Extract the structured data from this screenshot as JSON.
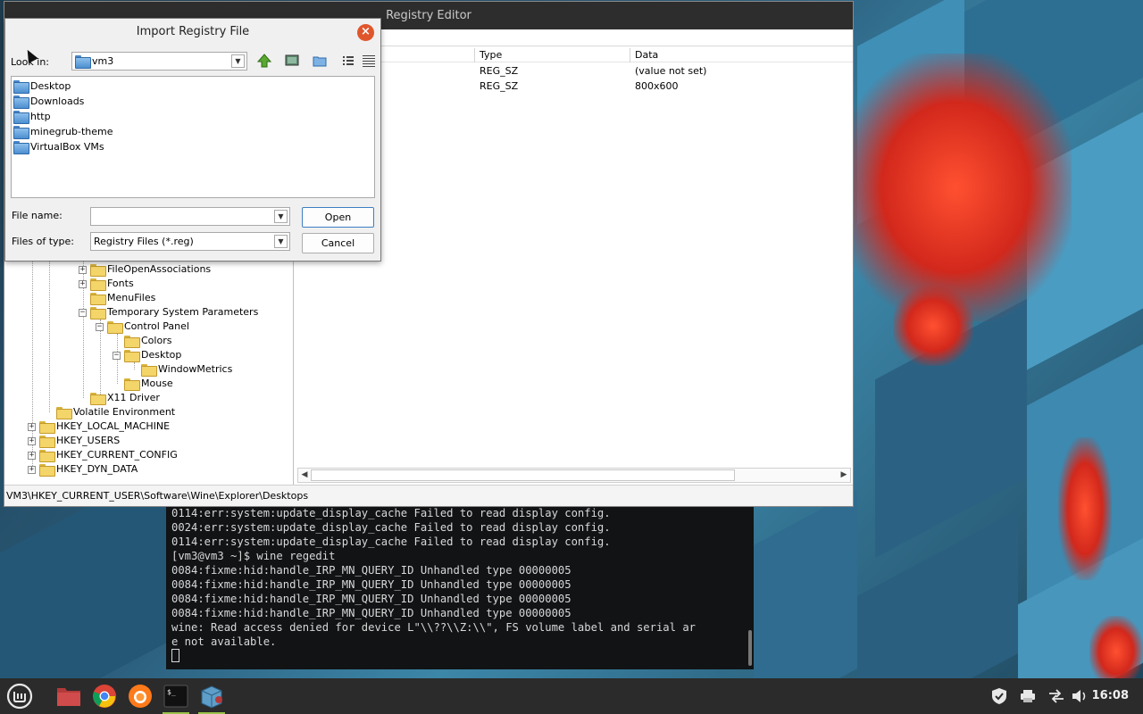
{
  "regedit": {
    "title": "Registry Editor",
    "tree": [
      {
        "label": "FileOpenAssociations",
        "toggle": "+"
      },
      {
        "label": "Fonts",
        "toggle": "+"
      },
      {
        "label": "MenuFiles",
        "toggle": ""
      },
      {
        "label": "Temporary System Parameters",
        "toggle": "−"
      },
      {
        "label": "Control Panel",
        "toggle": "−"
      },
      {
        "label": "Colors",
        "toggle": ""
      },
      {
        "label": "Desktop",
        "toggle": "−"
      },
      {
        "label": "WindowMetrics",
        "toggle": ""
      },
      {
        "label": "Mouse",
        "toggle": ""
      },
      {
        "label": "X11 Driver",
        "toggle": ""
      },
      {
        "label": "Volatile Environment",
        "toggle": ""
      },
      {
        "label": "HKEY_LOCAL_MACHINE",
        "toggle": "+"
      },
      {
        "label": "HKEY_USERS",
        "toggle": "+"
      },
      {
        "label": "HKEY_CURRENT_CONFIG",
        "toggle": "+"
      },
      {
        "label": "HKEY_DYN_DATA",
        "toggle": "+"
      }
    ],
    "columns": {
      "type": "Type",
      "data": "Data"
    },
    "rows": [
      {
        "type": "REG_SZ",
        "data": "(value not set)"
      },
      {
        "type": "REG_SZ",
        "data": "800x600"
      }
    ],
    "status_path": "VM3\\HKEY_CURRENT_USER\\Software\\Wine\\Explorer\\Desktops"
  },
  "dialog": {
    "title": "Import Registry File",
    "look_in_label": "Look in:",
    "look_in_value": "vm3",
    "files": [
      "Desktop",
      "Downloads",
      "http",
      "minegrub-theme",
      "VirtualBox VMs"
    ],
    "file_name_label": "File name:",
    "file_name_value": "",
    "file_type_label": "Files of type:",
    "file_type_value": "Registry Files (*.reg)",
    "open_label": "Open",
    "cancel_label": "Cancel"
  },
  "terminal": {
    "lines": [
      "0114:err:system:update_display_cache Failed to read display config.",
      "0024:err:system:update_display_cache Failed to read display config.",
      "0114:err:system:update_display_cache Failed to read display config.",
      "[vm3@vm3 ~]$ wine regedit",
      "0084:fixme:hid:handle_IRP_MN_QUERY_ID Unhandled type 00000005",
      "0084:fixme:hid:handle_IRP_MN_QUERY_ID Unhandled type 00000005",
      "0084:fixme:hid:handle_IRP_MN_QUERY_ID Unhandled type 00000005",
      "0084:fixme:hid:handle_IRP_MN_QUERY_ID Unhandled type 00000005",
      "wine: Read access denied for device L\"\\\\??\\\\Z:\\\\\", FS volume label and serial ar",
      "e not available."
    ]
  },
  "taskbar": {
    "clock": "16:08",
    "apps": [
      "mint-menu-icon",
      "files-icon",
      "chrome-icon",
      "firefox-icon",
      "terminal-icon",
      "wine-regedit-icon"
    ]
  },
  "colors": {
    "accent": "#e0562c",
    "taskbar": "#2b2b2b",
    "active_indicator": "#9ac14a"
  }
}
